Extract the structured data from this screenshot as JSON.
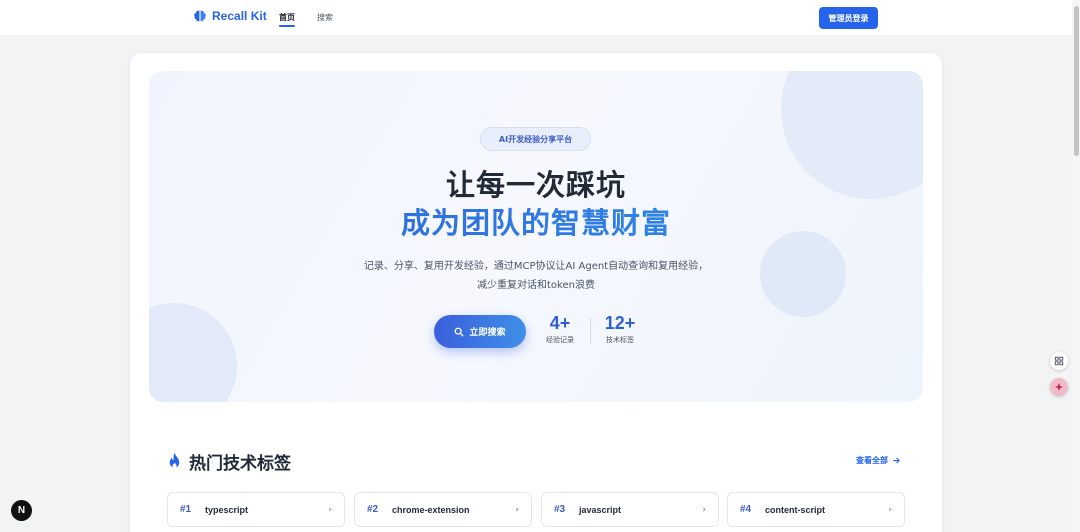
{
  "header": {
    "brand": "Recall Kit",
    "nav": {
      "home": "首页",
      "search": "搜索"
    },
    "admin_login": "管理员登录"
  },
  "hero": {
    "badge": "AI开发经验分享平台",
    "title_line1": "让每一次踩坑",
    "title_line2": "成为团队的智慧财富",
    "desc_line1": "记录、分享、复用开发经验，通过MCP协议让AI Agent自动查询和复用经验，",
    "desc_line2": "减少重复对话和token浪费",
    "search_button": "立即搜索",
    "stats": [
      {
        "value": "4+",
        "label": "经验记录"
      },
      {
        "value": "12+",
        "label": "技术标签"
      }
    ]
  },
  "section": {
    "title": "热门技术标签",
    "view_all": "查看全部"
  },
  "tags": [
    {
      "rank": "#1",
      "name": "typescript"
    },
    {
      "rank": "#2",
      "name": "chrome-extension"
    },
    {
      "rank": "#3",
      "name": "javascript"
    },
    {
      "rank": "#4",
      "name": "content-script"
    }
  ],
  "widgets": {
    "next_badge": "N"
  },
  "colors": {
    "primary": "#2563eb",
    "accent_gradient_end": "#2aa7e8"
  }
}
